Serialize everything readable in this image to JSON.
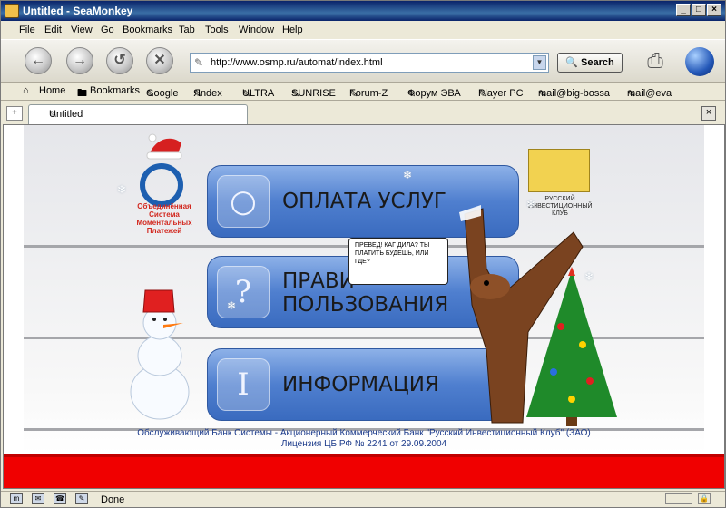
{
  "window": {
    "title": "Untitled - SeaMonkey"
  },
  "menu": [
    "File",
    "Edit",
    "View",
    "Go",
    "Bookmarks",
    "Tab",
    "Tools",
    "Window",
    "Help"
  ],
  "nav": {
    "url": "http://www.osmp.ru/automat/index.html",
    "search_label": "Search"
  },
  "bookmarks": [
    "Home",
    "Bookmarks",
    "Google",
    "Яndex",
    "ULTRA",
    "SUNRISE",
    "Forum-Z",
    "Форум ЭВА",
    "Player PC",
    "mail@big-bossa",
    "mail@eva"
  ],
  "tab": {
    "title": "Untitled"
  },
  "page": {
    "osmp_text": "Объединённая Система Моментальных Платежей",
    "rik_text": "РУССКИЙ ИНВЕСТИЦИОННЫЙ КЛУБ",
    "buttons": [
      {
        "label_lines": [
          "ОПЛАТА УСЛУГ"
        ],
        "icon": "bubbles-icon"
      },
      {
        "label_lines": [
          "ПРАВИ",
          "ПОЛЬЗОВАНИЯ"
        ],
        "icon": "question-icon"
      },
      {
        "label_lines": [
          "ИНФОРМАЦИЯ"
        ],
        "icon": "info-icon"
      }
    ],
    "bubble_text": "ПРЕВЕД! КАГ ДИЛА? ТЫ ПЛАТИТЬ БУДЕШЬ, ИЛИ ГДЕ?",
    "footer_line1": "Обслуживающий Банк Системы  - Акционерный Коммерческий Банк \"Русский Инвестиционный Клуб\" (ЗАО)",
    "footer_line2": "Лицензия ЦБ РФ № 2241 от 29.09.2004"
  },
  "status": {
    "text": "Done"
  },
  "colors": {
    "red_bar": "#f00000",
    "button_blue": "#4f7fcf",
    "title_blue": "#0a246a"
  }
}
